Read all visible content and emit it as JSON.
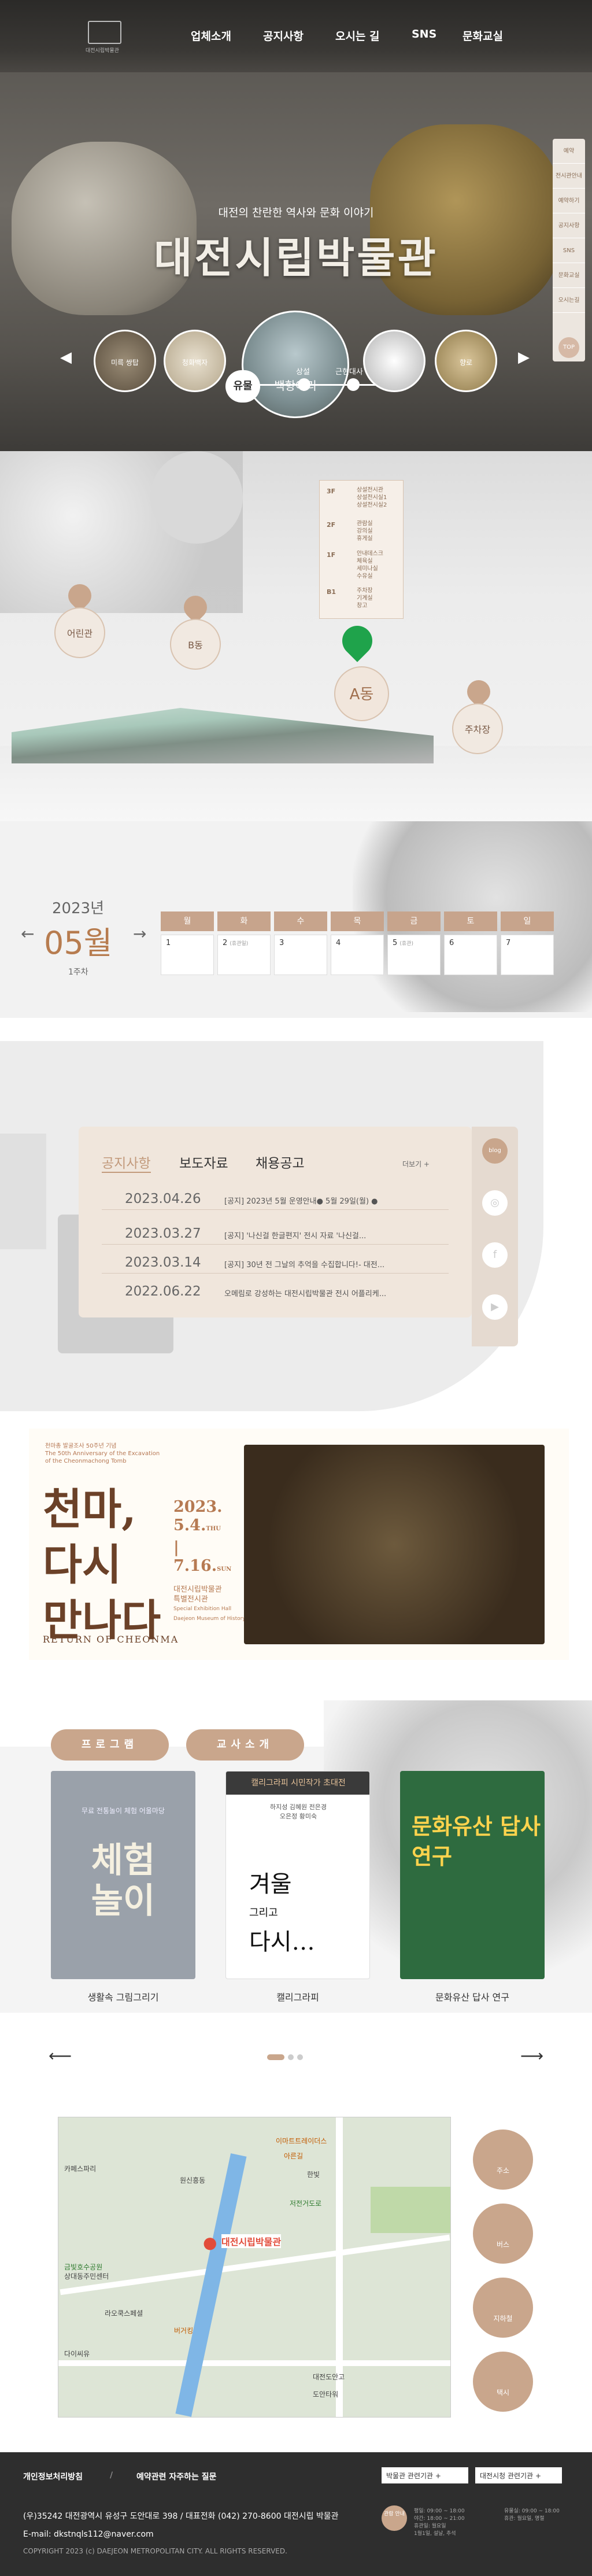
{
  "header": {
    "logo_text": "대전시립박물관",
    "nav": [
      "업체소개",
      "공지사항",
      "오시는 길",
      "SNS",
      "문화교실"
    ]
  },
  "hero": {
    "subtitle": "대전의 찬란한 역사와 문화 이야기",
    "title": "대전시립박물관",
    "items": [
      "미륵 쌍탑",
      "청화백자",
      "백항아리",
      "",
      "향로"
    ],
    "controls": {
      "button": "유물",
      "steps": [
        "상설",
        "근현대사"
      ]
    },
    "quick_menu": [
      "예약",
      "전시관안내",
      "예약하기",
      "공지사항",
      "SNS",
      "문화교실",
      "오시는길"
    ],
    "top": "TOP"
  },
  "building": {
    "pins": [
      "어린관",
      "B동",
      "A동",
      "주차장"
    ],
    "floors": [
      {
        "floor": "3F",
        "desc": [
          "상설전시관",
          "상설전시실1",
          "상설전시실2"
        ]
      },
      {
        "floor": "2F",
        "desc": [
          "관람실",
          "강의실",
          "휴게실"
        ]
      },
      {
        "floor": "1F",
        "desc": [
          "안내데스크",
          "체육실",
          "세미나실",
          "수유실"
        ]
      },
      {
        "floor": "B1",
        "desc": [
          "주차장",
          "기계실",
          "창고"
        ]
      }
    ]
  },
  "calendar": {
    "year": "2023년",
    "month": "05월",
    "week": "1주차",
    "days": [
      "월",
      "화",
      "수",
      "목",
      "금",
      "토",
      "일"
    ],
    "dates": [
      "1",
      "2",
      "3",
      "4",
      "5",
      "6",
      "7"
    ],
    "notes": [
      "",
      "(휴관일)",
      "",
      "",
      "(휴관)",
      "",
      ""
    ]
  },
  "notice": {
    "tabs": [
      "공지사항",
      "보도자료",
      "채용공고"
    ],
    "more": "더보기 +",
    "rows": [
      {
        "date": "2023.04.26",
        "title": "[공지] 2023년 5월 운영안내● 5월 29일(월) ●"
      },
      {
        "date": "2023.03.27",
        "title": "[공지] '나신걸 한글편지' 전시 자료 '나신걸..."
      },
      {
        "date": "2023.03.14",
        "title": "[공지] 30년 전 그날의 추억을 수집합니다!- 대전..."
      },
      {
        "date": "2022.06.22",
        "title": "오메림로 강성하는 대전시립박물관 전시 어플리케..."
      }
    ],
    "social": [
      "blog",
      "instagram-icon",
      "facebook-icon",
      "youtube-icon"
    ]
  },
  "exhibition": {
    "small": [
      "천마총 발굴조사 50주년 기념",
      "The 50th Anniversary of the Excavation",
      "of the Cheonmachong Tomb"
    ],
    "title": [
      "천마,",
      "다시",
      "만나다"
    ],
    "date": [
      "2023.",
      "5.4.",
      "|",
      "7.16."
    ],
    "date_sub": [
      "THU",
      "SUN"
    ],
    "org": [
      "대전시립박물관",
      "특별전시관",
      "Special Exhibition Hall",
      "Daejeon Museum of History"
    ],
    "return": "RETURN OF CHEONMA"
  },
  "programs": {
    "buttons": [
      "프로그램",
      "교사소개"
    ],
    "cards": [
      {
        "caption": "생활속 그림그리기",
        "text": [
          "무료 전통놀이 체험 어울마당",
          "체험",
          "놀이"
        ]
      },
      {
        "caption": "캘리그라피",
        "text": [
          "캘리그라피 시민작가 초대전",
          "하지성 김혜원 전은경",
          "오은정 황미숙",
          "겨울",
          "그리고",
          "다시…"
        ]
      },
      {
        "caption": "문화유산 답사 연구",
        "text": [
          "문화유산 답사",
          "연구"
        ]
      }
    ]
  },
  "map": {
    "labels": [
      "대전시립박물관",
      "이마트트레이더스",
      "아른길",
      "부평교회",
      "나도목",
      "카페스파리",
      "엑스포고",
      "한빛",
      "원신흥동",
      "저전거도로",
      "금빛호수공원",
      "상대동주민센터",
      "라오쿡스페셜",
      "대전도안고",
      "다이씨유",
      "서교",
      "버거킹",
      "도안타워"
    ],
    "buttons": [
      "주소",
      "버스",
      "지하철",
      "택시"
    ]
  },
  "footer": {
    "links": [
      "개인정보처리방침",
      "/",
      "예약관련 자주하는 질문"
    ],
    "selects": [
      "박물관 관련기관 +",
      "대전시청 관련기관 +"
    ],
    "line1": "(우)35242 대전광역시 유성구 도안대로 398 / 대표전화 (042) 270-8600 대전시립 박물관",
    "line2": "E-mail: dkstnqls112@naver.com",
    "copyright": "COPYRIGHT 2023 (c) DAEJEON METROPOLITAN CITY. ALL RIGHTS RESERVED.",
    "badge": "관람 안내",
    "hours": [
      "평일: 09:00 ~ 18:00",
      "야간: 18:00 ~ 21:00",
      "휴관일: 월요일",
      "1월1일, 설날, 추석"
    ],
    "hours2": [
      "유물실: 09:00 ~ 18:00",
      "휴관: 월요일, 명절"
    ]
  }
}
